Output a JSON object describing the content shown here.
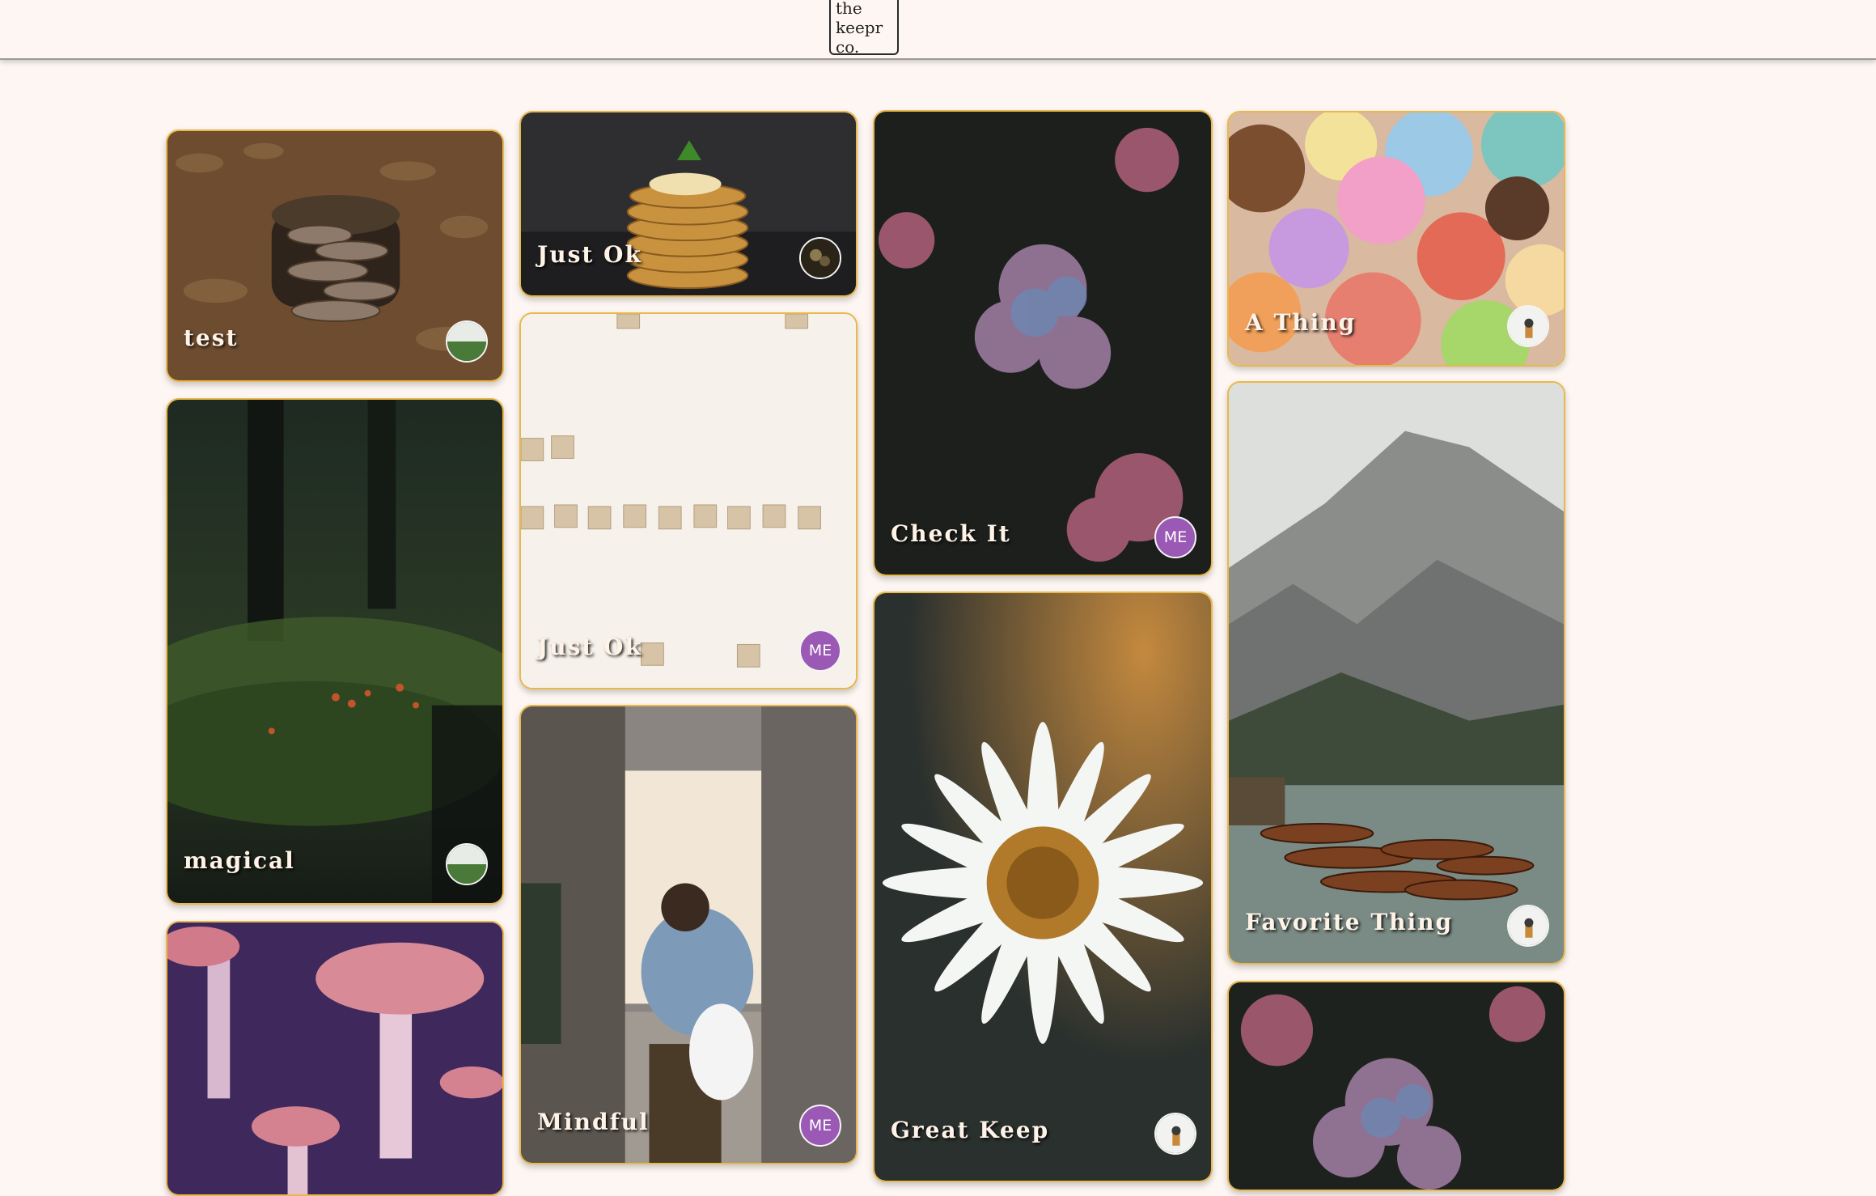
{
  "header": {
    "logo_lines": [
      "the",
      "keepr",
      "co."
    ]
  },
  "keeps": [
    {
      "title": "test",
      "creator_avatar": "photo-avatar"
    },
    {
      "title": "magical",
      "creator_avatar": "photo-avatar"
    },
    {
      "title": "",
      "creator_avatar": ""
    },
    {
      "title": "Just Ok",
      "creator_avatar": "photo-avatar"
    },
    {
      "title": "Just Ok",
      "creator_avatar": "ME"
    },
    {
      "title": "Mindful",
      "creator_avatar": "ME"
    },
    {
      "title": "Check It",
      "creator_avatar": "ME"
    },
    {
      "title": "Great Keep",
      "creator_avatar": "photo-avatar"
    },
    {
      "title": "A Thing",
      "creator_avatar": "photo-avatar"
    },
    {
      "title": "Favorite Thing",
      "creator_avatar": "photo-avatar"
    },
    {
      "title": "",
      "creator_avatar": ""
    }
  ],
  "colors": {
    "background": "#fdf6f2",
    "card_border": "#e8b84a",
    "me_avatar": "#9b59b6"
  }
}
